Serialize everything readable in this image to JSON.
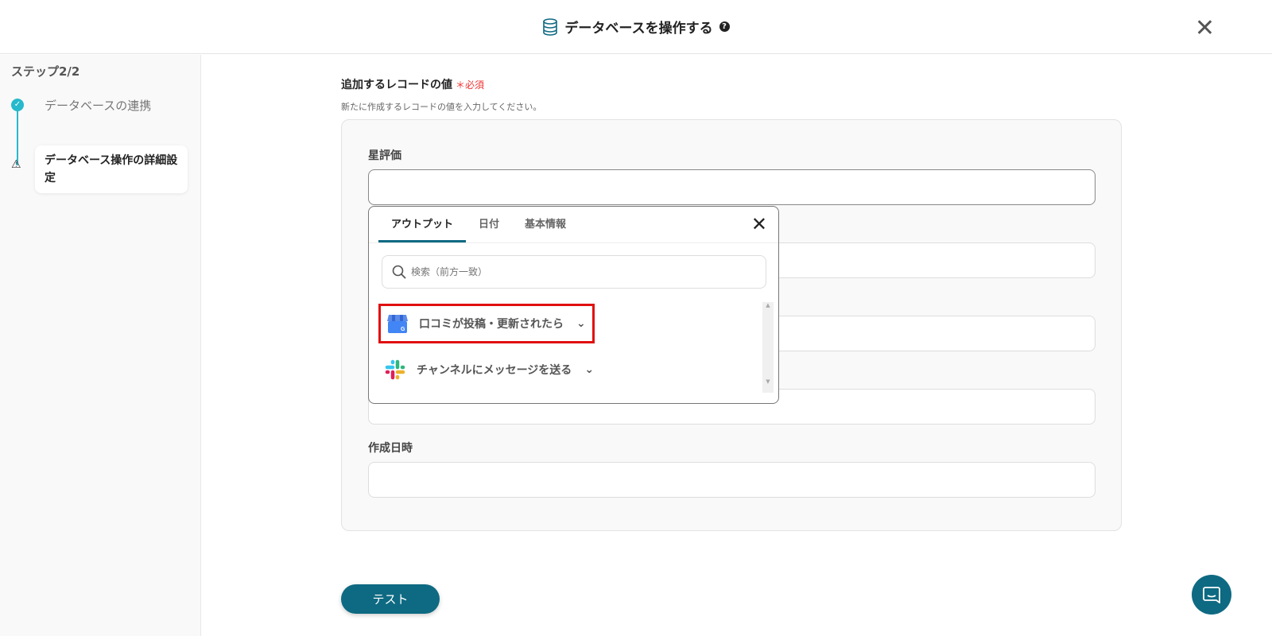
{
  "header": {
    "title": "データベースを操作する",
    "help_icon": "question-circle-icon",
    "close_icon": "close-icon"
  },
  "sidebar": {
    "step": "ステップ2/2",
    "items": [
      {
        "label": "データベースの連携",
        "status": "done"
      },
      {
        "label": "データベース操作の詳細設定",
        "status": "warning"
      }
    ]
  },
  "section": {
    "title": "追加するレコードの値",
    "required": "必須",
    "description": "新たに作成するレコードの値を入力してください。"
  },
  "fields": [
    {
      "label": "星評価",
      "value": ""
    },
    {
      "label": "作成日時",
      "value": ""
    }
  ],
  "popup": {
    "tabs": [
      "アウトプット",
      "日付",
      "基本情報"
    ],
    "selected_tab": "アウトプット",
    "search_placeholder": "検索（前方一致）",
    "items": [
      {
        "label": "口コミが投稿・更新されたら",
        "icon": "google-business-icon"
      },
      {
        "label": "チャンネルにメッセージを送る",
        "icon": "slack-icon"
      }
    ]
  },
  "test_button": "テスト",
  "colors": {
    "accent": "#0e6a82",
    "step": "#27b9cc",
    "required": "#e33333",
    "highlight": "#e01010"
  }
}
